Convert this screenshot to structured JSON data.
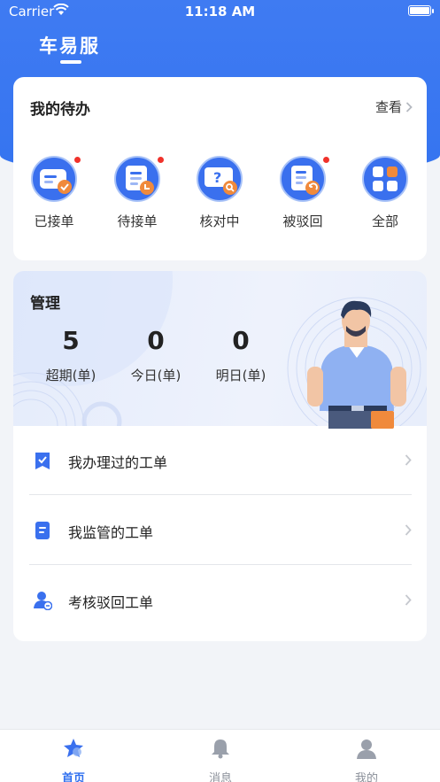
{
  "status_bar": {
    "carrier": "Carrier",
    "time": "11:18 AM"
  },
  "app": {
    "title": "车易服"
  },
  "todo": {
    "title": "我的待办",
    "more_label": "查看",
    "items": [
      {
        "label": "已接单",
        "icon": "accepted-order-icon",
        "has_dot": true
      },
      {
        "label": "待接单",
        "icon": "pending-order-icon",
        "has_dot": true
      },
      {
        "label": "核对中",
        "icon": "verifying-icon",
        "has_dot": false
      },
      {
        "label": "被驳回",
        "icon": "rejected-icon",
        "has_dot": true
      },
      {
        "label": "全部",
        "icon": "all-grid-icon",
        "has_dot": false
      }
    ]
  },
  "manage": {
    "title": "管理",
    "stats": [
      {
        "value": "5",
        "label": "超期(单)"
      },
      {
        "value": "0",
        "label": "今日(单)"
      },
      {
        "value": "0",
        "label": "明日(单)"
      }
    ],
    "menu": [
      {
        "label": "我办理过的工单",
        "icon": "handled-order-icon"
      },
      {
        "label": "我监管的工单",
        "icon": "supervised-order-icon"
      },
      {
        "label": "考核驳回工单",
        "icon": "review-rejected-icon"
      }
    ]
  },
  "tabbar": {
    "tabs": [
      {
        "label": "首页",
        "icon": "home-icon",
        "active": true
      },
      {
        "label": "消息",
        "icon": "bell-icon",
        "active": false
      },
      {
        "label": "我的",
        "icon": "profile-icon",
        "active": false
      }
    ]
  },
  "colors": {
    "brand_blue": "#3574f0",
    "red_dot": "#f0322b",
    "accent_orange": "#f08a3c"
  }
}
